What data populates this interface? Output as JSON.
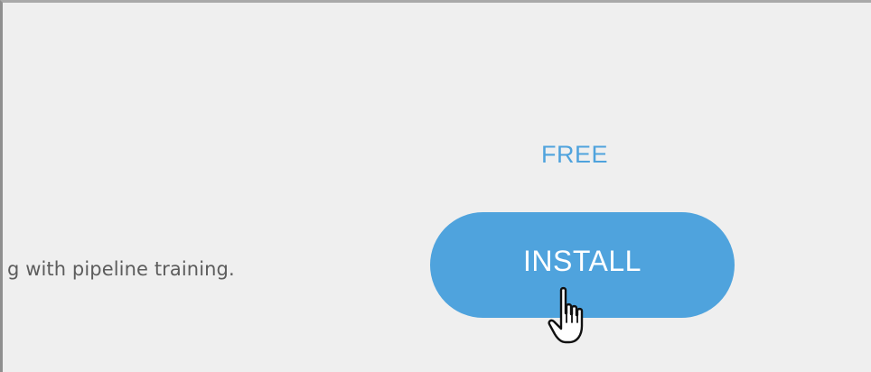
{
  "app": {
    "description_fragment": "g with pipeline training.",
    "price_label": "FREE",
    "install_button_label": "INSTALL"
  },
  "colors": {
    "panel_background": "#efefef",
    "accent_blue": "#4fa3dd",
    "button_text": "#ffffff",
    "body_text": "#5c5c5c"
  },
  "icons": {
    "cursor": "hand-pointer-cursor-icon"
  }
}
